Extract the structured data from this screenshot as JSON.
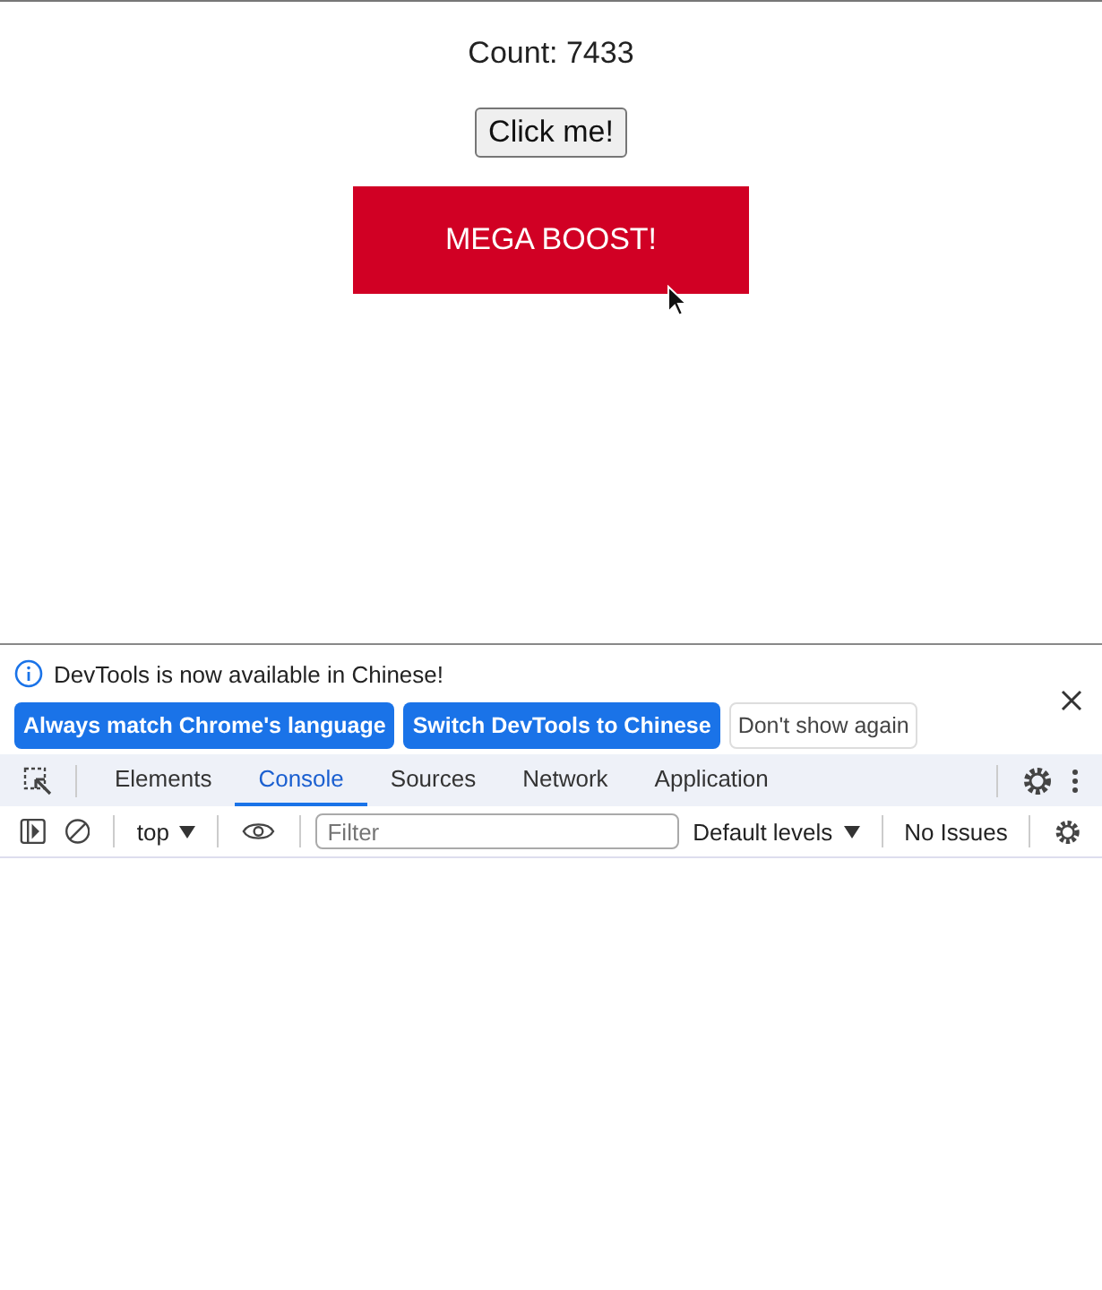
{
  "page": {
    "count": "Count: 7433",
    "click_button": "Click me!",
    "boost_button": "MEGA BOOST!"
  },
  "devtools": {
    "banner": {
      "message": "DevTools is now available in Chinese!",
      "buttons": [
        {
          "label": "Always match Chrome's language",
          "kind": "primary"
        },
        {
          "label": "Switch DevTools to Chinese",
          "kind": "primary"
        },
        {
          "label": "Don't show again",
          "kind": "secondary"
        }
      ]
    },
    "tabs": [
      {
        "label": "Elements",
        "selected": false
      },
      {
        "label": "Console",
        "selected": true
      },
      {
        "label": "Sources",
        "selected": false
      },
      {
        "label": "Network",
        "selected": false
      },
      {
        "label": "Application",
        "selected": false
      }
    ],
    "console_toolbar": {
      "context": "top",
      "filter_placeholder": "Filter",
      "levels": "Default levels",
      "issues": "No Issues"
    }
  }
}
